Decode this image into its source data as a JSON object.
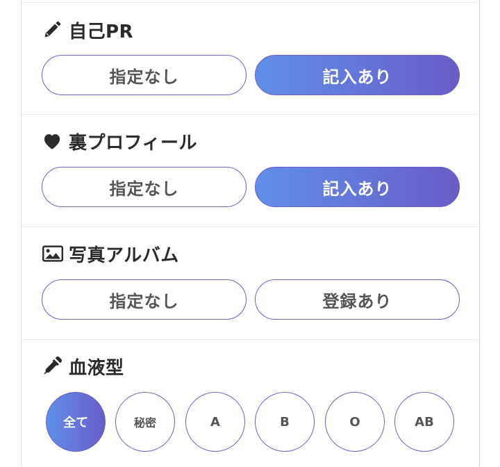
{
  "sections": {
    "self_pr": {
      "title": "自己PR",
      "icon": "pencil-icon",
      "options": [
        "指定なし",
        "記入あり"
      ],
      "selected": "記入あり"
    },
    "ura_profile": {
      "title": "裏プロフィール",
      "icon": "heart-icon",
      "options": [
        "指定なし",
        "記入あり"
      ],
      "selected": "記入あり"
    },
    "photo_album": {
      "title": "写真アルバム",
      "icon": "image-icon",
      "options": [
        "指定なし",
        "登録あり"
      ],
      "selected": "指定なし"
    },
    "blood_type": {
      "title": "血液型",
      "icon": "dropper-icon",
      "options": [
        "全て",
        "秘密",
        "A",
        "B",
        "O",
        "AB"
      ],
      "selected": "全て"
    }
  },
  "colors": {
    "accent_start": "#5f8fe8",
    "accent_end": "#6a5dc8",
    "border": "#6b64b6"
  }
}
